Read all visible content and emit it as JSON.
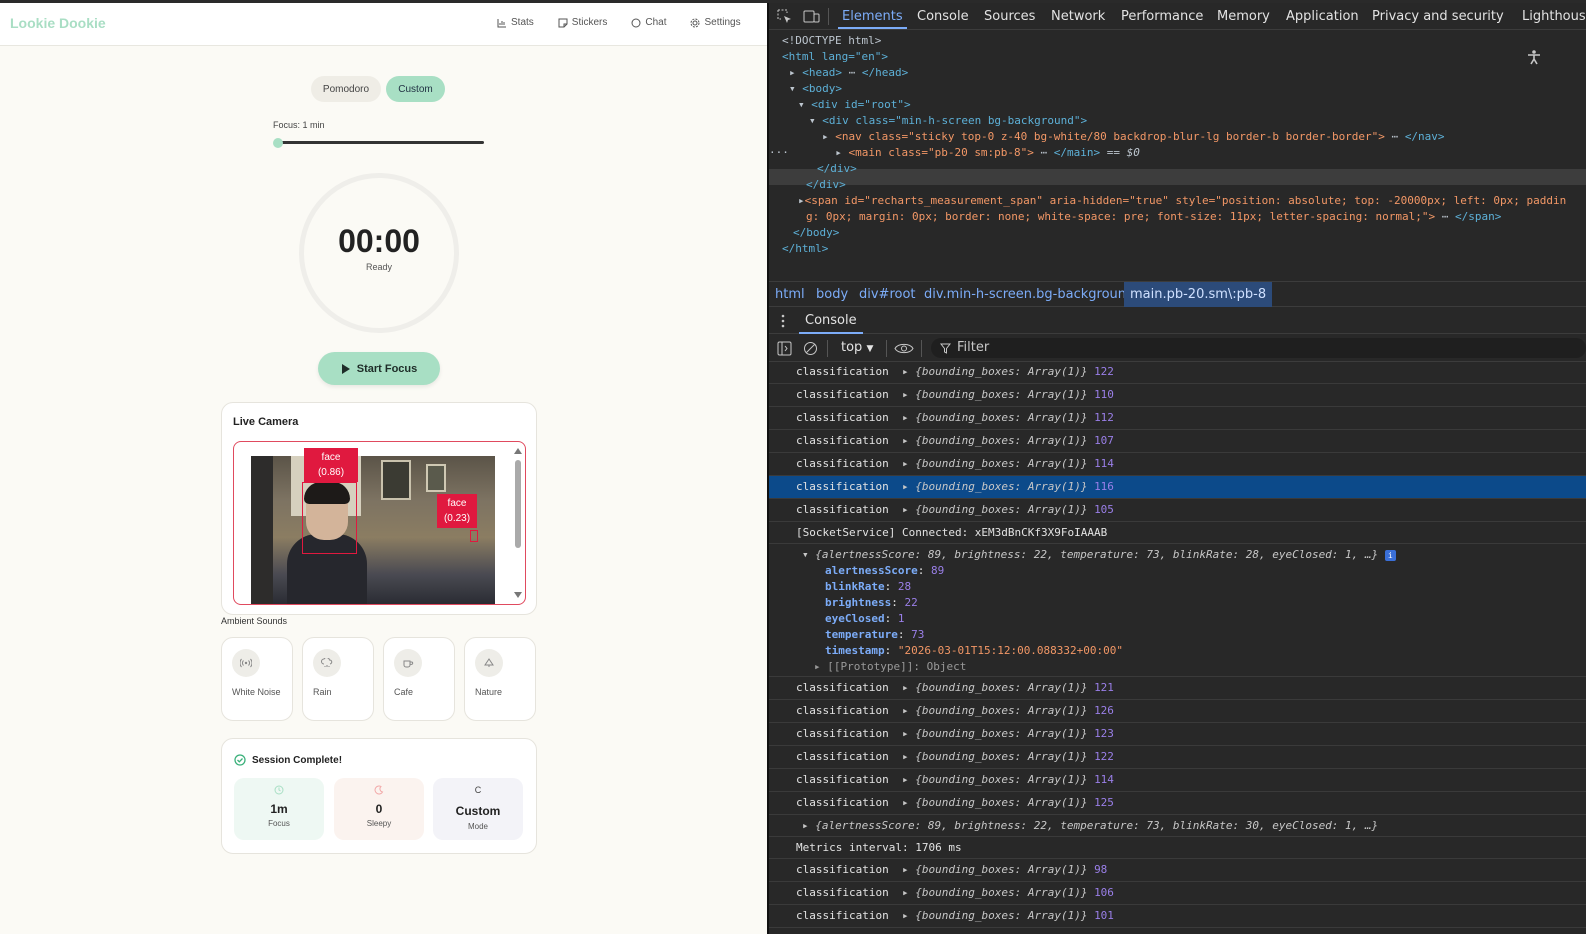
{
  "app": {
    "logo": "Lookie Dookie",
    "nav": [
      {
        "label": "Stats",
        "icon": "bar-chart-icon"
      },
      {
        "label": "Stickers",
        "icon": "sticker-icon"
      },
      {
        "label": "Chat",
        "icon": "chat-bubble-icon"
      },
      {
        "label": "Settings",
        "icon": "gear-icon"
      }
    ],
    "modes": [
      "Pomodoro",
      "Custom"
    ],
    "active_mode": "Custom",
    "focus_label": "Focus: 1 min",
    "focus_slider_fraction": 0.0,
    "timer": "00:00",
    "timer_status": "Ready",
    "start_button": "Start Focus",
    "camera": {
      "title": "Live Camera",
      "detections": [
        {
          "label": "face",
          "score": "(0.86)"
        },
        {
          "label": "face",
          "score": "(0.23)"
        }
      ]
    },
    "ambient_title": "Ambient Sounds",
    "sounds": [
      {
        "label": "White Noise",
        "icon": "radio-waves-icon"
      },
      {
        "label": "Rain",
        "icon": "rain-cloud-icon"
      },
      {
        "label": "Cafe",
        "icon": "coffee-cup-icon"
      },
      {
        "label": "Nature",
        "icon": "tree-icon"
      }
    ],
    "session": {
      "title": "Session Complete!",
      "stats": [
        {
          "value": "1m",
          "label": "Focus",
          "icon": "clock-icon",
          "color": "#eef8f3"
        },
        {
          "value": "0",
          "label": "Sleepy",
          "icon": "moon-icon",
          "color": "#fbf3ef"
        },
        {
          "value": "Custom",
          "label": "Mode",
          "icon": "c-icon",
          "color": "#f3f3f8"
        }
      ]
    }
  },
  "devtools": {
    "tabs": [
      "Elements",
      "Console",
      "Sources",
      "Network",
      "Performance",
      "Memory",
      "Application",
      "Privacy and security",
      "Lighthouse"
    ],
    "active_tab": "Elements",
    "dom": {
      "doctype": "<!DOCTYPE html>",
      "html_open": "<html lang=\"en\">",
      "head": "<head>",
      "head_close": "</head>",
      "body": "<body>",
      "root": "<div id=\"root\">",
      "bg_div": "<div class=\"min-h-screen bg-background\">",
      "nav": "<nav class=\"sticky top-0 z-40 bg-white/80 backdrop-blur-lg border-b border-border\">",
      "nav_close": "</nav>",
      "main": "<main class=\"pb-20 sm:pb-8\">",
      "main_close": "</main>",
      "main_suffix": "== $0",
      "div_close": "</div>",
      "div_close2": "</div>",
      "span_line1": "<span id=\"recharts_measurement_span\" aria-hidden=\"true\" style=\"position: absolute; top: -20000px; left: 0px; paddin",
      "span_line2": "g: 0px; margin: 0px; border: none; white-space: pre; font-size: 11px; letter-spacing: normal;\">",
      "span_close": "</span>",
      "body_close": "</body>",
      "html_close": "</html>"
    },
    "breadcrumbs": [
      "html",
      "body",
      "div#root",
      "div.min-h-screen.bg-background",
      "main.pb-20.sm\\:pb-8"
    ],
    "drawer_tab": "Console",
    "context": "top",
    "filter_placeholder": "Filter",
    "logs_a": [
      {
        "k": "classification",
        "o": "{bounding_boxes: Array(1)}",
        "n": "122"
      },
      {
        "k": "classification",
        "o": "{bounding_boxes: Array(1)}",
        "n": "110"
      },
      {
        "k": "classification",
        "o": "{bounding_boxes: Array(1)}",
        "n": "112"
      },
      {
        "k": "classification",
        "o": "{bounding_boxes: Array(1)}",
        "n": "107"
      },
      {
        "k": "classification",
        "o": "{bounding_boxes: Array(1)}",
        "n": "114"
      },
      {
        "k": "classification",
        "o": "{bounding_boxes: Array(1)}",
        "n": "116"
      },
      {
        "k": "classification",
        "o": "{bounding_boxes: Array(1)}",
        "n": "105"
      }
    ],
    "socket_line": "[SocketService] Connected: xEM3dBnCKf3X9FoIAAAB",
    "metrics_obj": "{alertnessScore: 89, brightness: 22, temperature: 73, blinkRate: 28, eyeClosed: 1, …}",
    "metrics_props": [
      {
        "k": "alertnessScore",
        "v": "89",
        "t": "n"
      },
      {
        "k": "blinkRate",
        "v": "28",
        "t": "n"
      },
      {
        "k": "brightness",
        "v": "22",
        "t": "n"
      },
      {
        "k": "eyeClosed",
        "v": "1",
        "t": "n"
      },
      {
        "k": "temperature",
        "v": "73",
        "t": "n"
      },
      {
        "k": "timestamp",
        "v": "\"2026-03-01T15:12:00.088332+00:00\"",
        "t": "s"
      }
    ],
    "prototype_line": "[[Prototype]]: Object",
    "logs_b": [
      {
        "k": "classification",
        "o": "{bounding_boxes: Array(1)}",
        "n": "121"
      },
      {
        "k": "classification",
        "o": "{bounding_boxes: Array(1)}",
        "n": "126"
      },
      {
        "k": "classification",
        "o": "{bounding_boxes: Array(1)}",
        "n": "123"
      },
      {
        "k": "classification",
        "o": "{bounding_boxes: Array(1)}",
        "n": "122"
      },
      {
        "k": "classification",
        "o": "{bounding_boxes: Array(1)}",
        "n": "114"
      },
      {
        "k": "classification",
        "o": "{bounding_boxes: Array(1)}",
        "n": "125"
      }
    ],
    "metrics_obj2": "{alertnessScore: 89, brightness: 22, temperature: 73, blinkRate: 30, eyeClosed: 1, …}",
    "interval_line": "Metrics interval: 1706 ms",
    "logs_c": [
      {
        "k": "classification",
        "o": "{bounding_boxes: Array(1)}",
        "n": "98"
      },
      {
        "k": "classification",
        "o": "{bounding_boxes: Array(1)}",
        "n": "106"
      },
      {
        "k": "classification",
        "o": "{bounding_boxes: Array(1)}",
        "n": "101"
      }
    ]
  }
}
